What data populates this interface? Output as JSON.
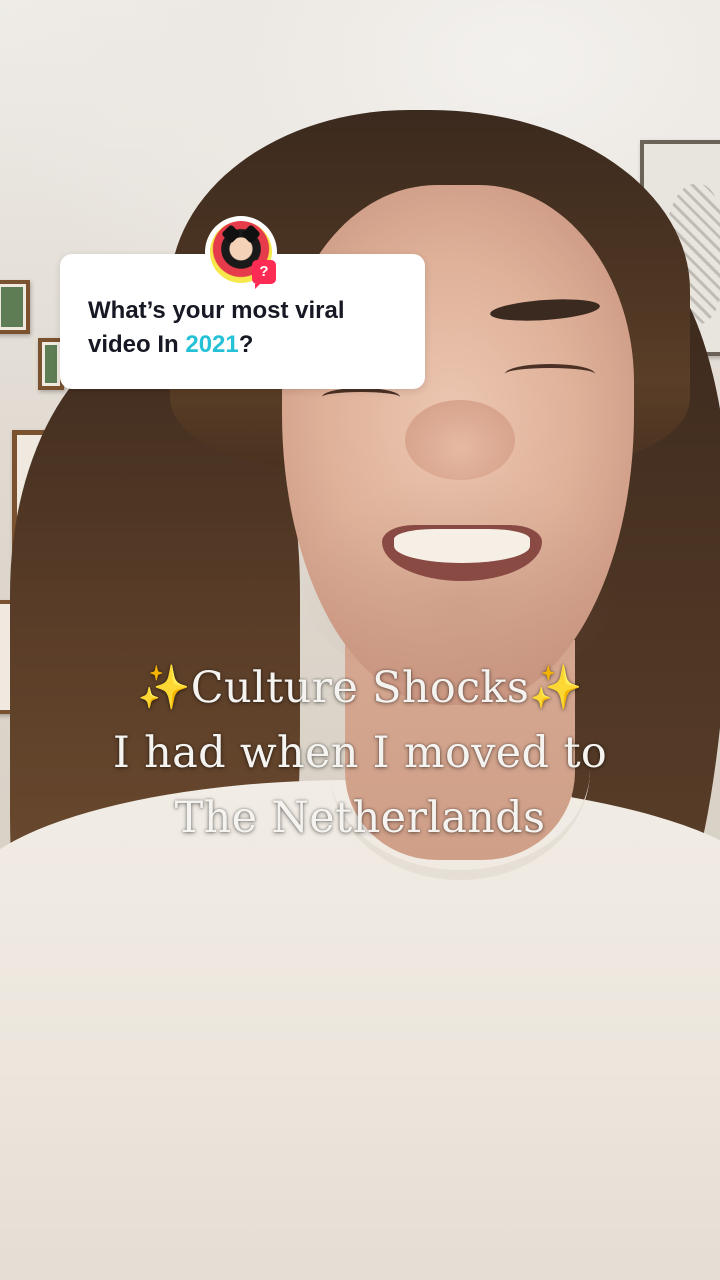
{
  "question_sticker": {
    "text_before": "What’s your most viral video In ",
    "highlight": "2021",
    "text_after": "?",
    "badge": "?",
    "highlight_color": "#25c1d6",
    "badge_color": "#fe2c55"
  },
  "caption": {
    "line1_sparkle_left": "✨",
    "line1": "Culture Shocks",
    "line1_sparkle_right": "✨",
    "line2": "I had when I moved to",
    "line3": "The Netherlands"
  }
}
